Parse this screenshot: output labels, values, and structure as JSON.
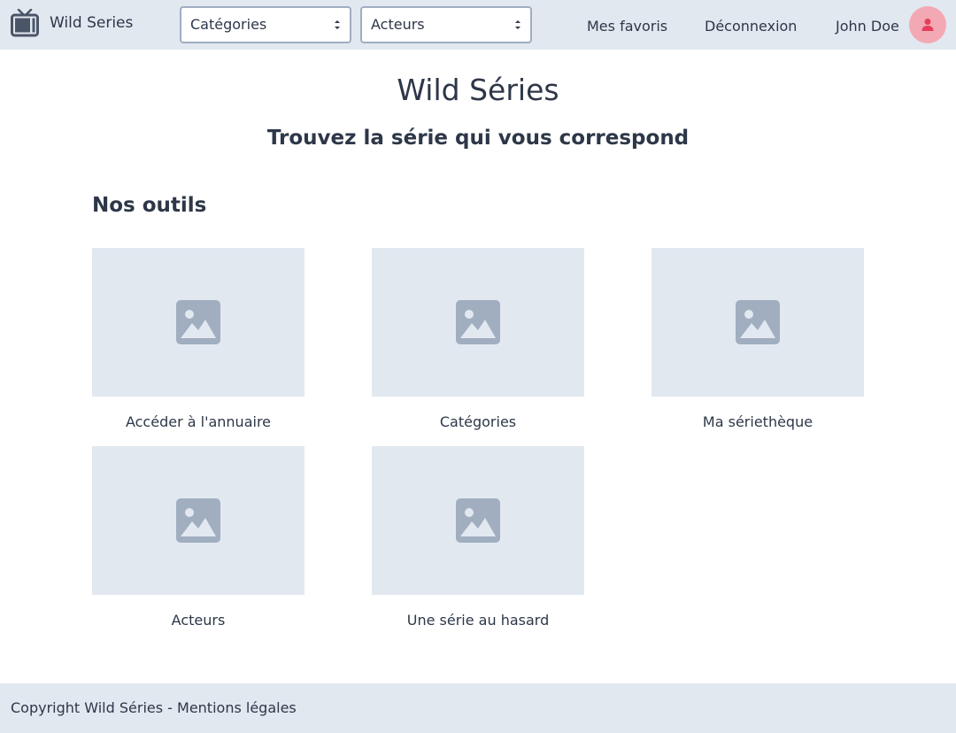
{
  "header": {
    "brand": "Wild Series",
    "brand_icon": "tv-icon",
    "categories_select": {
      "selected": "Catégories"
    },
    "actors_select": {
      "selected": "Acteurs"
    },
    "favorites_link": "Mes favoris",
    "logout_link": "Déconnexion",
    "user_name": "John Doe",
    "avatar_icon": "user-icon",
    "avatar_color": "#f3a9b4"
  },
  "main": {
    "title": "Wild Séries",
    "subtitle": "Trouvez la série qui vous correspond",
    "section_title": "Nos outils",
    "tools": [
      {
        "label": "Accéder à l'annuaire",
        "icon": "image-placeholder-icon"
      },
      {
        "label": "Catégories",
        "icon": "image-placeholder-icon"
      },
      {
        "label": "Ma sériethèque",
        "icon": "image-placeholder-icon"
      },
      {
        "label": "Acteurs",
        "icon": "image-placeholder-icon"
      },
      {
        "label": "Une série au hasard",
        "icon": "image-placeholder-icon"
      }
    ]
  },
  "footer": {
    "copyright": "Copyright Wild Séries - ",
    "legal_link": "Mentions légales"
  },
  "colors": {
    "nav_background": "#e2e8f0",
    "text": "#2d3748",
    "placeholder_icon": "#a0aec0"
  }
}
